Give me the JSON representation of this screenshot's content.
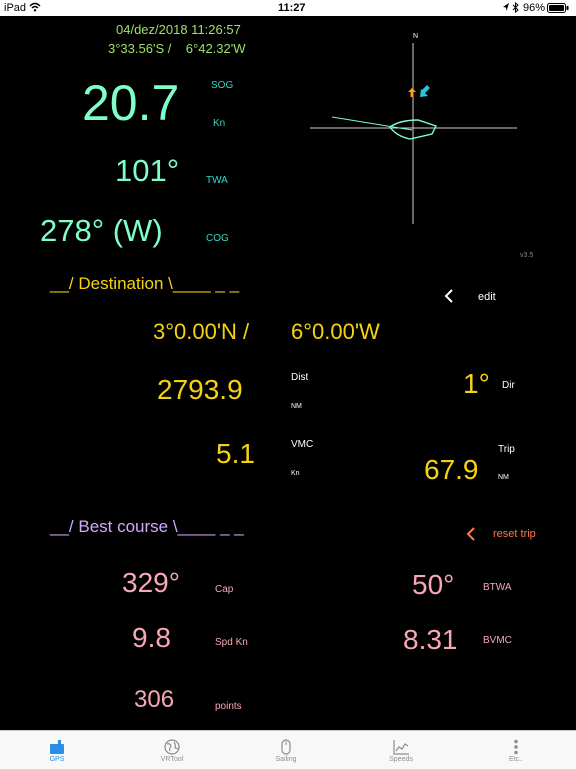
{
  "status": {
    "device": "iPad",
    "time": "11:27",
    "battery": "96%"
  },
  "header": {
    "datetime": "04/dez/2018 11:26:57",
    "position": "3°33.56'S /    6°42.32'W"
  },
  "gps": {
    "sog_value": "20.7",
    "sog_label": "SOG",
    "sog_unit": "Kn",
    "twa_value": "101°",
    "twa_label": "TWA",
    "cog_value": "278° (W)",
    "cog_label": "COG"
  },
  "compass": {
    "north_label": "N",
    "version": "v3.5"
  },
  "destination": {
    "header": "__/ Destination \\____ _ _",
    "edit_label": "edit",
    "lat": "3°0.00'N /",
    "lon": "6°0.00'W",
    "dist_value": "2793.9",
    "dist_label": "Dist",
    "dist_unit": "NM",
    "dir_value": "1°",
    "dir_label": "Dir",
    "vmc_value": "5.1",
    "vmc_label": "VMC",
    "vmc_unit": "Kn",
    "trip_value": "67.9",
    "trip_label": "Trip",
    "trip_unit": "NM"
  },
  "best_course": {
    "header": "__/ Best course \\____ _ _",
    "reset_label": "reset trip",
    "cap_value": "329°",
    "cap_label": "Cap",
    "btwa_value": "50°",
    "btwa_label": "BTWA",
    "spd_value": "9.8",
    "spd_label": "Spd Kn",
    "bvmc_value": "8.31",
    "bvmc_label": "BVMC",
    "points_value": "306",
    "points_label": "points"
  },
  "tabs": [
    {
      "label": "GPS",
      "icon": "gps-icon",
      "active": true
    },
    {
      "label": "VRTool",
      "icon": "globe-icon",
      "active": false
    },
    {
      "label": "Sailing",
      "icon": "mouse-icon",
      "active": false
    },
    {
      "label": "Speeds",
      "icon": "chart-icon",
      "active": false
    },
    {
      "label": "Etc..",
      "icon": "more-icon",
      "active": false
    }
  ],
  "colors": {
    "accent_tab": "#2a8ee8",
    "green": "#9fe06a",
    "teal": "#7fffc8",
    "yellow": "#f5d40f",
    "pink": "#f7a8b4",
    "violet": "#d3a6ff",
    "orange": "#ff7a45"
  }
}
